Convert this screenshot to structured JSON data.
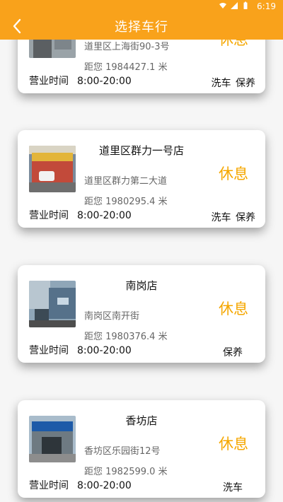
{
  "status_bar": {
    "time": "6:19"
  },
  "header": {
    "title": "选择车行"
  },
  "stores": [
    {
      "name": "",
      "status": "休息",
      "address": "道里区上海街90-3号",
      "distance": "距您 1984427.1 米",
      "hours_label": "营业时间",
      "hours": "8:00-20:00",
      "services": "洗车 保养"
    },
    {
      "name": "道里区群力一号店",
      "status": "休息",
      "address": "道里区群力第二大道",
      "distance": "距您 1980295.4 米",
      "hours_label": "营业时间",
      "hours": "8:00-20:00",
      "services": "洗车 保养"
    },
    {
      "name": "南岗店",
      "status": "休息",
      "address": "南岗区南开街",
      "distance": "距您 1980376.4 米",
      "hours_label": "营业时间",
      "hours": "8:00-20:00",
      "services": "保养"
    },
    {
      "name": "香坊店",
      "status": "休息",
      "address": "香坊区乐园街12号",
      "distance": "距您 1982599.0 米",
      "hours_label": "营业时间",
      "hours": "8:00-20:00",
      "services": "洗车"
    }
  ]
}
